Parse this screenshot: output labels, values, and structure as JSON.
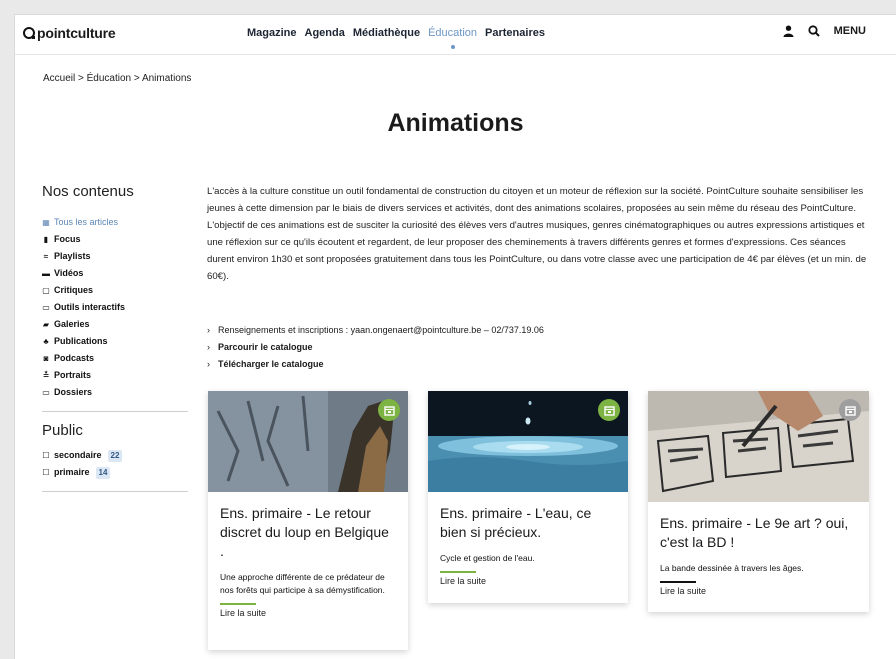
{
  "logo": "pointculture",
  "nav": [
    "Magazine",
    "Agenda",
    "Médiathèque",
    "Éducation",
    "Partenaires"
  ],
  "nav_active_index": 3,
  "menu_label": "MENU",
  "breadcrumb": "Accueil > Éducation > Animations",
  "page_title": "Animations",
  "sidebar": {
    "contents_title": "Nos contenus",
    "items": [
      {
        "label": "Tous les articles",
        "icon": "grid-icon",
        "active": true
      },
      {
        "label": "Focus",
        "icon": "document-icon"
      },
      {
        "label": "Playlists",
        "icon": "playlist-icon"
      },
      {
        "label": "Vidéos",
        "icon": "video-icon"
      },
      {
        "label": "Critiques",
        "icon": "critique-icon"
      },
      {
        "label": "Outils interactifs",
        "icon": "tools-icon"
      },
      {
        "label": "Galeries",
        "icon": "gallery-icon"
      },
      {
        "label": "Publications",
        "icon": "publication-icon"
      },
      {
        "label": "Podcasts",
        "icon": "podcast-icon"
      },
      {
        "label": "Portraits",
        "icon": "portrait-icon"
      },
      {
        "label": "Dossiers",
        "icon": "folder-icon"
      }
    ],
    "public_title": "Public",
    "public_items": [
      {
        "label": "secondaire",
        "count": "22"
      },
      {
        "label": "primaire",
        "count": "14"
      }
    ]
  },
  "intro": "L'accès à la culture constitue un outil fondamental de construction du citoyen et un moteur de réflexion sur la société. PointCulture souhaite sensibiliser les jeunes à cette dimension par le biais de divers services et activités, dont des animations scolaires, proposées au sein même du réseau des PointCulture. L'objectif de ces animations est de susciter la curiosité des élèves vers d'autres musiques, genres cinématographiques ou autres expressions artistiques et une réflexion sur ce qu'ils écoutent et regardent, de leur proposer des cheminements à travers différents genres et formes d'expressions. Ces séances durent environ 1h30 et sont proposées gratuitement dans tous les PointCulture, ou dans votre classe avec une participation de 4€ par élèves (et un min. de 60€).",
  "links": {
    "info_prefix": "Renseignements et inscriptions :",
    "info_contact": "yaan.ongenaert@pointculture.be – 02/737.19.06",
    "catalogue_browse": "Parcourir le catalogue",
    "catalogue_download": "Télécharger le catalogue"
  },
  "cards": [
    {
      "title": "Ens. primaire - Le retour discret du loup en Belgique .",
      "desc": "Une approche différente de ce prédateur de nos forêts qui participe à sa démystification.",
      "more": "Lire la suite",
      "badge_color": "#7cb342",
      "bar_color": "#7cb342"
    },
    {
      "title": "Ens. primaire - L'eau, ce bien si précieux.",
      "desc": "Cycle et gestion de l'eau.",
      "more": "Lire la suite",
      "badge_color": "#7cb342",
      "bar_color": "#7cb342"
    },
    {
      "title": "Ens. primaire - Le 9e art ? oui, c'est la BD !",
      "desc": "La bande dessinée à travers les âges.",
      "more": "Lire la suite",
      "badge_color": "#9e9e9e",
      "bar_color": "#111111"
    }
  ]
}
